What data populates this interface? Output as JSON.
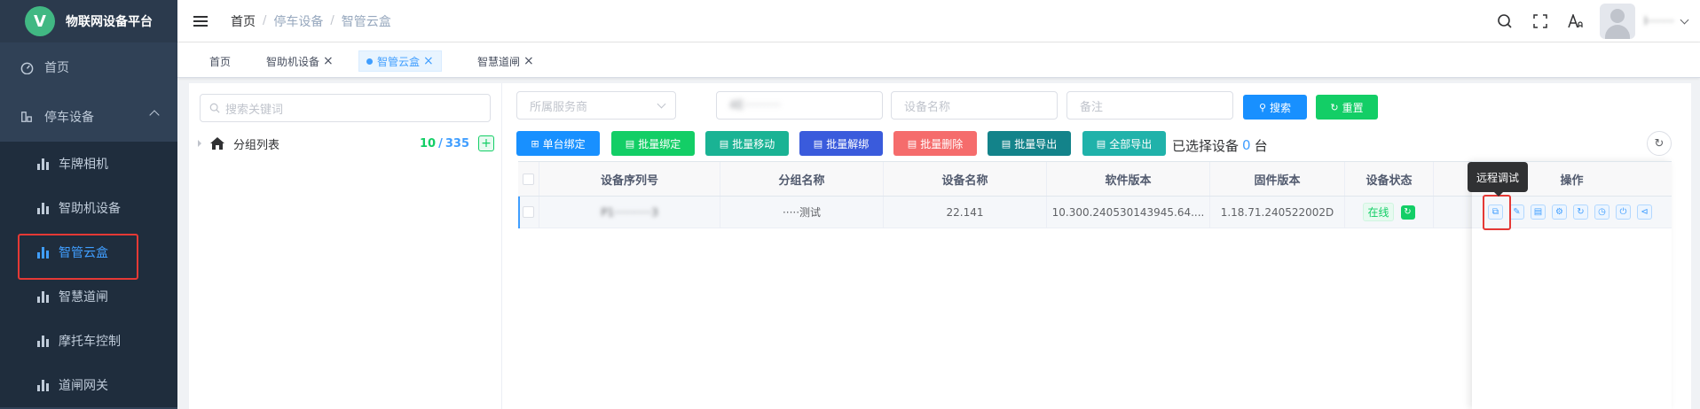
{
  "app": {
    "logo_letter": "V",
    "title": "物联网设备平台"
  },
  "sidebar": {
    "items": [
      {
        "label": "首页"
      },
      {
        "label": "停车设备"
      }
    ],
    "sub_items": [
      {
        "label": "车牌相机"
      },
      {
        "label": "智助机设备"
      },
      {
        "label": "智管云盒"
      },
      {
        "label": "智慧道闸"
      },
      {
        "label": "摩托车控制"
      },
      {
        "label": "道闸网关"
      }
    ],
    "active_sub": "智管云盒"
  },
  "header": {
    "breadcrumb": [
      "首页",
      "停车设备",
      "智管云盒"
    ],
    "user_name": "l········"
  },
  "tags": [
    {
      "label": "首页"
    },
    {
      "label": "智助机设备",
      "close": "×"
    },
    {
      "label": "智管云盒",
      "close": "×"
    },
    {
      "label": "智慧道闸",
      "close": "×"
    }
  ],
  "left_panel": {
    "search_placeholder": "搜索关键词",
    "tree_root": "分组列表",
    "count_online": "10",
    "count_sep": "/",
    "count_total": "335",
    "add_symbol": "+"
  },
  "filters": {
    "provider_placeholder": "所属服务商",
    "serial_value": "4E··········",
    "name_placeholder": "设备名称",
    "remark_placeholder": "备注"
  },
  "buttons": {
    "search": "搜索",
    "reset": "重置",
    "single_bind": "单台绑定",
    "batch_bind": "批量绑定",
    "batch_move": "批量移动",
    "batch_unbind": "批量解绑",
    "batch_delete": "批量删除",
    "batch_export": "批量导出",
    "export_all": "全部导出"
  },
  "selection": {
    "prefix": "已选择设备",
    "count": "0",
    "suffix": "台"
  },
  "table": {
    "headers": [
      "设备序列号",
      "分组名称",
      "设备名称",
      "软件版本",
      "固件版本",
      "设备状态",
      "操作"
    ],
    "rows": [
      {
        "serial": "P1···········3",
        "group": "·····测试",
        "name": "22.141",
        "software": "10.300.240530143945.64....",
        "firmware": "1.18.71.240522002D",
        "status": "在线"
      }
    ]
  },
  "tooltip": "远程调试",
  "colors": {
    "primary": "#409eff",
    "success": "#13ce66",
    "teal": "#1ab394",
    "indigo": "#3a5bdc",
    "danger": "#f56c6c",
    "dark_teal": "#13838a",
    "sidebar_bg": "#304156",
    "highlight": "#e53935"
  }
}
